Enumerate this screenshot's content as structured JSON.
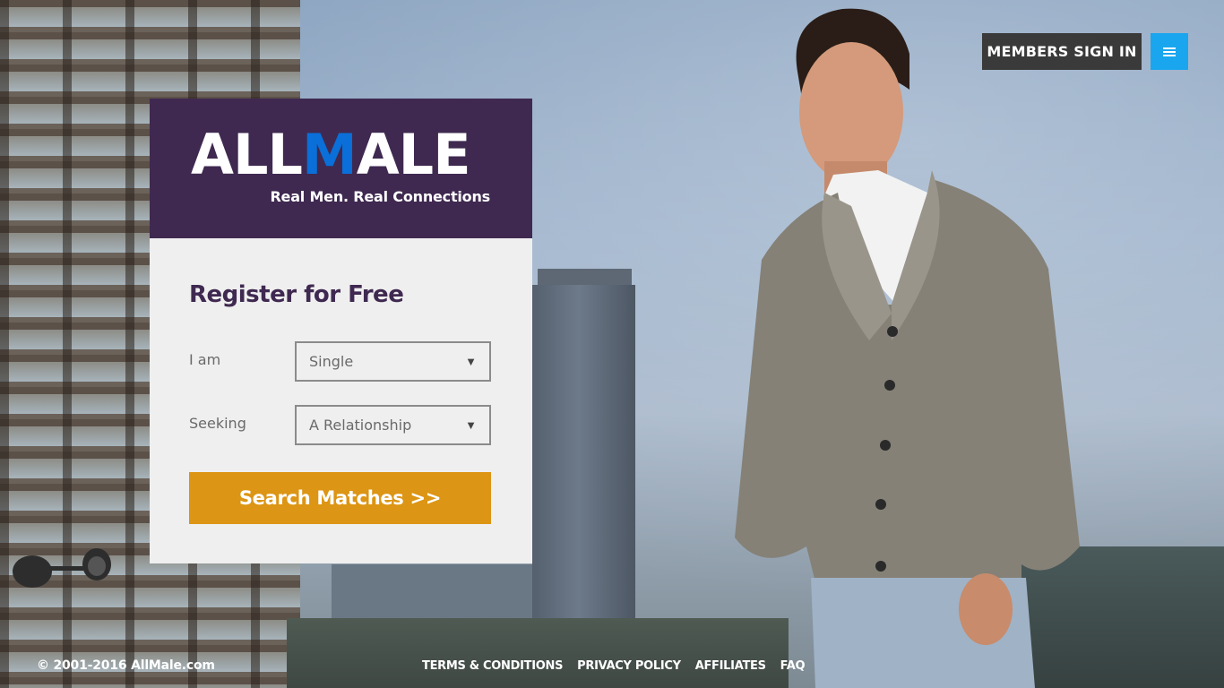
{
  "header": {
    "signin_label": "MEMBERS SIGN IN",
    "menu_icon": "hamburger-menu-icon",
    "menu_color": "#1aa6ee",
    "signin_bg": "#3a3a3a"
  },
  "logo": {
    "part1": "ALL",
    "part2": "M",
    "part3": "ALE",
    "tagline": "Real Men. Real Connections",
    "brand_color": "#3f2950",
    "accent_color": "#0a6fd8"
  },
  "form": {
    "title": "Register for Free",
    "iam_label": "I am",
    "iam_value": "Single",
    "seeking_label": "Seeking",
    "seeking_value": "A Relationship",
    "dropdown_icon": "triangle-down-icon",
    "submit_label": "Search Matches >>",
    "submit_color": "#dc9514"
  },
  "footer": {
    "copyright": "© 2001-2016 AllMale.com",
    "links": [
      "TERMS & CONDITIONS",
      "PRIVACY POLICY",
      "AFFILIATES",
      "FAQ"
    ]
  }
}
